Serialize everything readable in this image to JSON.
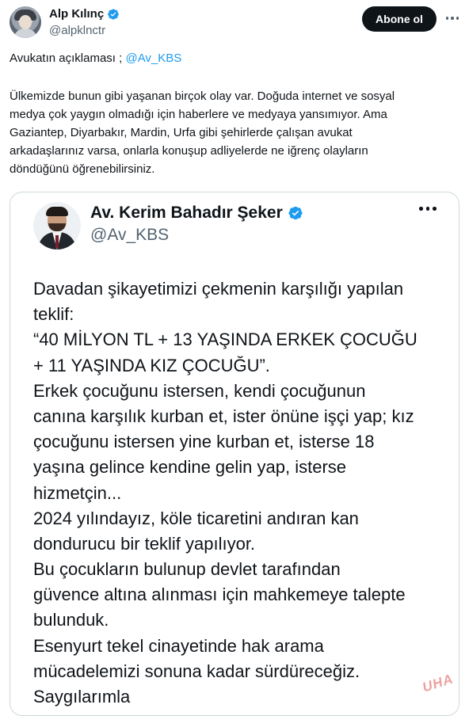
{
  "author": {
    "display_name": "Alp Kılınç",
    "handle": "@alpklnctr",
    "verified": true
  },
  "actions": {
    "follow_label": "Abone ol",
    "more_icon": "ellipsis-icon"
  },
  "tweet": {
    "intro": "Avukatın açıklaması ; ",
    "mention": "@Av_KBS",
    "body_lines": [
      "Ülkemizde bunun gibi yaşanan birçok olay var. Doğuda internet ve sosyal",
      "medya çok yaygın olmadığı için haberlere ve medyaya yansımıyor. Ama",
      "Gaziantep, Diyarbakır, Mardin, Urfa gibi şehirlerde çalışan avukat",
      "arkadaşlarınız varsa, onlarla konuşup adliyelerde ne iğrenç olayların",
      "döndüğünü öğrenebilirsiniz."
    ]
  },
  "embedded": {
    "display_name": "Av. Kerim Bahadır Şeker",
    "handle": "@Av_KBS",
    "verified": true,
    "text_lines": [
      "Davadan şikayetimizi çekmenin karşılığı yapılan",
      "teklif:",
      "“40 MİLYON TL + 13 YAŞINDA ERKEK ÇOCUĞU",
      "+ 11 YAŞINDA KIZ ÇOCUĞU”.",
      "Erkek çocuğunu istersen, kendi çocuğunun",
      "canına karşılık kurban et, ister önüne işçi yap; kız",
      "çocuğunu istersen yine kurban et, isterse 18",
      "yaşına gelince kendine gelin yap, isterse",
      "hizmetçin...",
      "2024 yılındayız, köle ticaretini andıran kan",
      "dondurucu bir teklif yapılıyor.",
      "Bu çocukların bulunup devlet tarafından",
      "güvence altına alınması için mahkemeye talepte",
      "bulunduk.",
      "Esenyurt tekel cinayetinde hak arama",
      "mücadelemizi sonuna kadar sürdüreceğiz.",
      "Saygılarımla"
    ],
    "watermark": "UHA"
  },
  "colors": {
    "accent": "#1d9bf0",
    "text": "#0f1419",
    "muted": "#536471",
    "border": "#cfd9de",
    "button_bg": "#0f1419"
  }
}
